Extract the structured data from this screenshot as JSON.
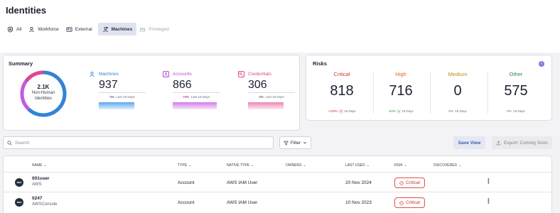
{
  "page": {
    "title": "Identities"
  },
  "tabs": [
    {
      "label": "All",
      "icon": "shield-user-icon",
      "active": false
    },
    {
      "label": "Workforce",
      "icon": "person-icon",
      "active": false
    },
    {
      "label": "External",
      "icon": "id-card-icon",
      "active": false
    },
    {
      "label": "Machines",
      "icon": "machine-user-icon",
      "active": true
    },
    {
      "label": "Privileged",
      "icon": "crown-icon",
      "active": false,
      "disabled": true
    }
  ],
  "summary": {
    "title": "Summary",
    "total_value": "2.1K",
    "total_label_line1": "Non-Human",
    "total_label_line2": "Identities",
    "metrics": [
      {
        "label": "Machines",
        "value": "937",
        "change": "0%",
        "period": "Last 19 Days",
        "color": "#2f7fd8"
      },
      {
        "label": "Accounts",
        "value": "866",
        "change": "+0%",
        "period": "Last 19 Days",
        "color": "#b44fd6"
      },
      {
        "label": "Credentials",
        "value": "306",
        "change": "0%",
        "period": "Last 19 Days",
        "color": "#e0478f"
      }
    ]
  },
  "risks": {
    "title": "Risks",
    "items": [
      {
        "label": "Critical",
        "value": "818",
        "change": "+100%",
        "period": "19 Days",
        "color": "#d3372f",
        "change_color": "#d3372f"
      },
      {
        "label": "High",
        "value": "716",
        "change": "-53%",
        "period": "19 Days",
        "color": "#e0661f",
        "change_color": "#2e9a4a"
      },
      {
        "label": "Medium",
        "value": "0",
        "change": "0%",
        "period": "19 Days",
        "color": "#c48a10",
        "change_color": "#6a6e7b"
      },
      {
        "label": "Other",
        "value": "575",
        "change": "0%",
        "period": "19 Days",
        "color": "#2e8a43",
        "change_color": "#6a6e7b"
      }
    ]
  },
  "toolbar": {
    "search_placeholder": "Search",
    "filter_label": "Filter",
    "save_view_label": "Save View",
    "export_label": "Export: Coming Soon"
  },
  "table": {
    "columns": [
      "NAME",
      "TYPE",
      "NATIVE TYPE",
      "OWNERS",
      "LAST USED",
      "RISK",
      "DISCOVERED"
    ],
    "rows": [
      {
        "logo": "aws",
        "name": "001user",
        "sub": "AWS",
        "type": "Account",
        "native_type": "AWS IAM User",
        "owners": "",
        "last_used": "20 Nov 2024",
        "risk": "Critical",
        "discovered": ""
      },
      {
        "logo": "aws",
        "name": "0247",
        "sub": "AWSConsole",
        "type": "Account",
        "native_type": "AWS IAM User",
        "owners": "",
        "last_used": "10 Nov 2023",
        "risk": "Critical",
        "discovered": ""
      }
    ]
  }
}
